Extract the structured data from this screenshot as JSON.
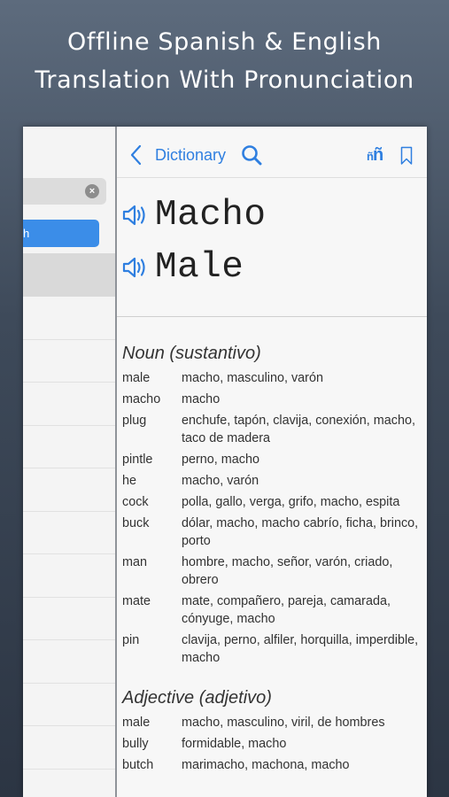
{
  "promo": {
    "line1": "Offline Spanish & English",
    "line2": "Translation With Pronunciation"
  },
  "left_panel": {
    "segment_label": "h"
  },
  "navbar": {
    "back_label": "Dictionary",
    "accent_color": "#2f7fe0"
  },
  "headwords": {
    "spanish": "Macho",
    "english": "Male"
  },
  "sections": [
    {
      "heading": "Noun (sustantivo)",
      "entries": [
        {
          "en": "male",
          "es": "macho, masculino, varón"
        },
        {
          "en": "macho",
          "es": "macho"
        },
        {
          "en": "plug",
          "es": "enchufe, tapón, clavija, conexión, macho, taco de madera"
        },
        {
          "en": "pintle",
          "es": "perno, macho"
        },
        {
          "en": "he",
          "es": "macho, varón"
        },
        {
          "en": "cock",
          "es": "polla, gallo, verga, grifo, macho, espita"
        },
        {
          "en": "buck",
          "es": "dólar, macho, macho cabrío, ficha, brinco, porto"
        },
        {
          "en": "man",
          "es": "hombre, macho, señor, varón, criado, obrero"
        },
        {
          "en": "mate",
          "es": "mate, compañero, pareja, camarada, cónyuge, macho"
        },
        {
          "en": "pin",
          "es": "clavija, perno, alfiler, horquilla, imperdible, macho"
        }
      ]
    },
    {
      "heading": "Adjective (adjetivo)",
      "entries": [
        {
          "en": "male",
          "es": "macho, masculino, viril, de hombres"
        },
        {
          "en": "bully",
          "es": "formidable, macho"
        },
        {
          "en": "butch",
          "es": "marimacho, machona, macho"
        }
      ]
    }
  ]
}
